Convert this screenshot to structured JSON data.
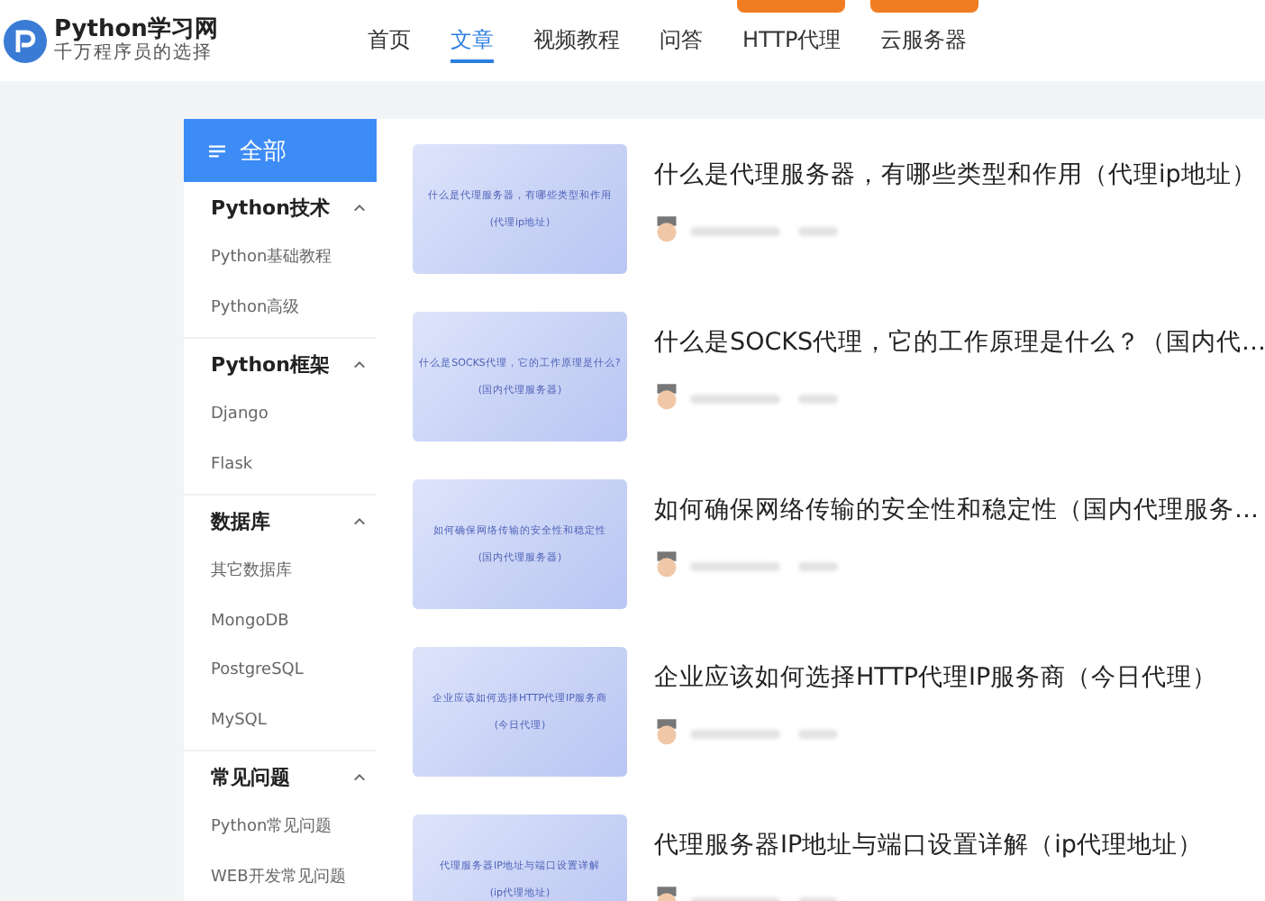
{
  "logo": {
    "title": "Python学习网",
    "subtitle": "千万程序员的选择"
  },
  "nav": [
    {
      "label": "首页",
      "selected": false,
      "badge": false
    },
    {
      "label": "文章",
      "selected": true,
      "badge": false
    },
    {
      "label": "视频教程",
      "selected": false,
      "badge": false
    },
    {
      "label": "问答",
      "selected": false,
      "badge": false
    },
    {
      "label": "HTTP代理",
      "selected": false,
      "badge": true
    },
    {
      "label": "云服务器",
      "selected": false,
      "badge": true
    }
  ],
  "sidebar": {
    "all": {
      "label": "全部",
      "selected": true
    },
    "groups": [
      {
        "label": "Python技术",
        "expanded": true,
        "items": [
          "Python基础教程",
          "Python高级"
        ]
      },
      {
        "label": "Python框架",
        "expanded": true,
        "items": [
          "Django",
          "Flask"
        ]
      },
      {
        "label": "数据库",
        "expanded": true,
        "items": [
          "其它数据库",
          "MongoDB",
          "PostgreSQL",
          "MySQL"
        ]
      },
      {
        "label": "常见问题",
        "expanded": true,
        "items": [
          "Python常见问题",
          "WEB开发常见问题"
        ]
      }
    ]
  },
  "articles": [
    {
      "title": "什么是代理服务器，有哪些类型和作用（代理ip地址）",
      "cover": [
        "什么是代理服务器，有哪些类型和作用",
        "(代理ip地址)"
      ]
    },
    {
      "title": "什么是SOCKS代理，它的工作原理是什么？（国内代…",
      "cover": [
        "什么是SOCKS代理，它的工作原理是什么?",
        "(国内代理服务器)"
      ]
    },
    {
      "title": "如何确保网络传输的安全性和稳定性（国内代理服务…",
      "cover": [
        "如何确保网络传输的安全性和稳定性",
        "(国内代理服务器)"
      ]
    },
    {
      "title": "企业应该如何选择HTTP代理IP服务商（今日代理）",
      "cover": [
        "企业应该如何选择HTTP代理IP服务商",
        "(今日代理)"
      ]
    },
    {
      "title": "代理服务器IP地址与端口设置详解（ip代理地址）",
      "cover": [
        "代理服务器IP地址与端口设置详解",
        "(ip代理地址)"
      ]
    }
  ]
}
